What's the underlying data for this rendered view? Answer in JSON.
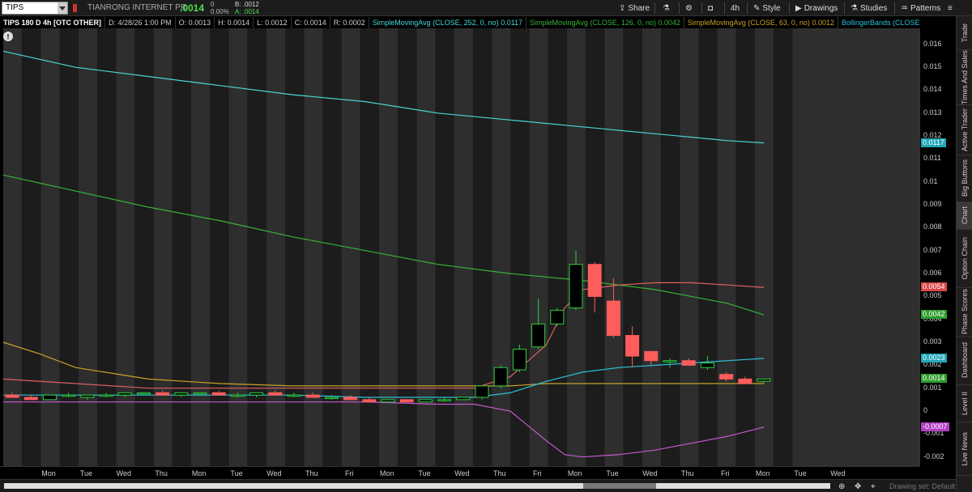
{
  "toolbar": {
    "symbol": "TIPS",
    "company": "TIANRONG INTERNET PR",
    "last": ".0014",
    "change": "0",
    "change_pct": "0.00%",
    "bid": "B: .0012",
    "ask": "A: .0014",
    "buttons": {
      "share": "Share",
      "timeframe": "4h",
      "style": "Style",
      "drawings": "Drawings",
      "studies": "Studies",
      "patterns": "Patterns"
    }
  },
  "infobar": {
    "title": "TIPS 180 D 4h [OTC OTHER]",
    "date": "D: 4/28/26 1:00 PM",
    "open": "O: 0.0013",
    "high": "H: 0.0014",
    "low": "L: 0.0012",
    "close": "C: 0.0014",
    "range": "R: 0.0002",
    "study1": "SimpleMovingAvg (CLOSE, 252, 0, no)",
    "study1_val": "0.0117",
    "study2": "SimpleMovingAvg (CLOSE, 126, 0, no)",
    "study2_val": "0.0042",
    "study3": "SimpleMovingAvg (CLOSE, 63, 0, no)",
    "study3_val": "0.0012",
    "study4": "BollingerBands (CLOSE, 0, 20,..."
  },
  "colors": {
    "sma252": "#4ad6d6",
    "sma126": "#36b336",
    "sma63": "#c9a227",
    "bb_upper": "#e06060",
    "bb_mid": "#2bc0d8",
    "bb_lower": "#c65ad0",
    "up": "#2ecc40",
    "down": "#ff5c5c"
  },
  "yaxis": {
    "ticks": [
      "0.016",
      "0.015",
      "0.014",
      "0.013",
      "0.012",
      "0.011",
      "0.01",
      "0.009",
      "0.008",
      "0.007",
      "0.006",
      "0.005",
      "0.004",
      "0.003",
      "0.002",
      "0.001",
      "0",
      "-0.001",
      "-0.002"
    ],
    "badges": [
      {
        "label": "0.0117",
        "value": 0.0117,
        "color": "#1fa6b8"
      },
      {
        "label": "0.0054",
        "value": 0.0054,
        "color": "#d94848"
      },
      {
        "label": "0.0042",
        "value": 0.0042,
        "color": "#2e9e2e"
      },
      {
        "label": "0.0023",
        "value": 0.0023,
        "color": "#1fa6b8"
      },
      {
        "label": "0.0014",
        "value": 0.0014,
        "color": "#2e9e2e"
      },
      {
        "label": "-0.0007",
        "value": -0.0007,
        "color": "#b33fc4"
      }
    ]
  },
  "xaxis": {
    "labels": [
      "Mon",
      "Tue",
      "Wed",
      "Thu",
      "Mon",
      "Tue",
      "Wed",
      "Thu",
      "Fri",
      "Mon",
      "Tue",
      "Wed",
      "Thu",
      "Fri",
      "Mon",
      "Tue",
      "Wed",
      "Thu",
      "Fri",
      "Mon",
      "Tue",
      "Wed"
    ]
  },
  "chart_data": {
    "type": "candlestick",
    "ylim": [
      -0.0024,
      0.0167
    ],
    "candles": [
      {
        "o": 0.0007,
        "h": 0.0008,
        "l": 0.0006,
        "c": 0.0006
      },
      {
        "o": 0.0006,
        "h": 0.0007,
        "l": 0.0005,
        "c": 0.0005
      },
      {
        "o": 0.0005,
        "h": 0.0007,
        "l": 0.0005,
        "c": 0.0007
      },
      {
        "o": 0.0007,
        "h": 0.0008,
        "l": 0.0006,
        "c": 0.0007
      },
      {
        "o": 0.0006,
        "h": 0.0007,
        "l": 0.0005,
        "c": 0.0007
      },
      {
        "o": 0.0007,
        "h": 0.0008,
        "l": 0.0006,
        "c": 0.0007
      },
      {
        "o": 0.0007,
        "h": 0.0008,
        "l": 0.0006,
        "c": 0.0008
      },
      {
        "o": 0.0008,
        "h": 0.0008,
        "l": 0.0007,
        "c": 0.0008
      },
      {
        "o": 0.0008,
        "h": 0.0009,
        "l": 0.0007,
        "c": 0.0007
      },
      {
        "o": 0.0007,
        "h": 0.0008,
        "l": 0.0006,
        "c": 0.0008
      },
      {
        "o": 0.0008,
        "h": 0.0008,
        "l": 0.0007,
        "c": 0.0008
      },
      {
        "o": 0.0008,
        "h": 0.0009,
        "l": 0.0007,
        "c": 0.0007
      },
      {
        "o": 0.0007,
        "h": 0.0008,
        "l": 0.0006,
        "c": 0.0007
      },
      {
        "o": 0.0007,
        "h": 0.0008,
        "l": 0.0006,
        "c": 0.0008
      },
      {
        "o": 0.0008,
        "h": 0.0009,
        "l": 0.0007,
        "c": 0.0007
      },
      {
        "o": 0.0007,
        "h": 0.0008,
        "l": 0.0006,
        "c": 0.0007
      },
      {
        "o": 0.0007,
        "h": 0.0008,
        "l": 0.0006,
        "c": 0.0006
      },
      {
        "o": 0.0006,
        "h": 0.0007,
        "l": 0.0005,
        "c": 0.0006
      },
      {
        "o": 0.0006,
        "h": 0.0007,
        "l": 0.0005,
        "c": 0.0005
      },
      {
        "o": 0.0005,
        "h": 0.0006,
        "l": 0.0004,
        "c": 0.0004
      },
      {
        "o": 0.0004,
        "h": 0.0005,
        "l": 0.0004,
        "c": 0.0005
      },
      {
        "o": 0.0005,
        "h": 0.0005,
        "l": 0.0004,
        "c": 0.0004
      },
      {
        "o": 0.0004,
        "h": 0.0005,
        "l": 0.0004,
        "c": 0.0005
      },
      {
        "o": 0.0005,
        "h": 0.0006,
        "l": 0.0004,
        "c": 0.0005
      },
      {
        "o": 0.0005,
        "h": 0.0006,
        "l": 0.0005,
        "c": 0.0006
      },
      {
        "o": 0.0006,
        "h": 0.0011,
        "l": 0.0005,
        "c": 0.0011
      },
      {
        "o": 0.0011,
        "h": 0.002,
        "l": 0.001,
        "c": 0.0019
      },
      {
        "o": 0.0018,
        "h": 0.0029,
        "l": 0.0017,
        "c": 0.0027
      },
      {
        "o": 0.0028,
        "h": 0.0049,
        "l": 0.0027,
        "c": 0.0038
      },
      {
        "o": 0.0038,
        "h": 0.0045,
        "l": 0.0037,
        "c": 0.0044
      },
      {
        "o": 0.0045,
        "h": 0.007,
        "l": 0.0044,
        "c": 0.0064
      },
      {
        "o": 0.0064,
        "h": 0.0065,
        "l": 0.0043,
        "c": 0.005
      },
      {
        "o": 0.0048,
        "h": 0.0058,
        "l": 0.0032,
        "c": 0.0033
      },
      {
        "o": 0.0033,
        "h": 0.0037,
        "l": 0.0019,
        "c": 0.0024
      },
      {
        "o": 0.0026,
        "h": 0.0026,
        "l": 0.002,
        "c": 0.0022
      },
      {
        "o": 0.0022,
        "h": 0.0023,
        "l": 0.0019,
        "c": 0.0022
      },
      {
        "o": 0.0022,
        "h": 0.0023,
        "l": 0.002,
        "c": 0.002
      },
      {
        "o": 0.0019,
        "h": 0.0024,
        "l": 0.0018,
        "c": 0.0021
      },
      {
        "o": 0.0016,
        "h": 0.0017,
        "l": 0.0013,
        "c": 0.0014
      },
      {
        "o": 0.0014,
        "h": 0.0015,
        "l": 0.0012,
        "c": 0.0012
      },
      {
        "o": 0.0013,
        "h": 0.0014,
        "l": 0.0012,
        "c": 0.0014
      }
    ],
    "sma252": {
      "x": [
        0,
        20,
        40,
        60,
        80,
        100,
        120,
        140,
        160,
        180,
        200,
        210
      ],
      "y": [
        0.0157,
        0.015,
        0.0146,
        0.0142,
        0.0138,
        0.0135,
        0.013,
        0.0127,
        0.0124,
        0.0121,
        0.0118,
        0.0117
      ]
    },
    "sma126": {
      "x": [
        0,
        20,
        40,
        60,
        80,
        100,
        120,
        140,
        160,
        180,
        200,
        210
      ],
      "y": [
        0.0103,
        0.0096,
        0.0089,
        0.0083,
        0.0076,
        0.007,
        0.0064,
        0.006,
        0.0057,
        0.0053,
        0.0047,
        0.0042
      ]
    },
    "sma63": {
      "x": [
        0,
        10,
        20,
        40,
        60,
        80,
        100,
        120,
        130,
        140,
        150,
        160,
        180,
        210
      ],
      "y": [
        0.003,
        0.0025,
        0.0019,
        0.0014,
        0.0012,
        0.0011,
        0.0011,
        0.0011,
        0.0011,
        0.0011,
        0.0012,
        0.0012,
        0.0012,
        0.0012
      ]
    },
    "bb_upper": {
      "x": [
        0,
        20,
        40,
        60,
        80,
        100,
        120,
        130,
        140,
        150,
        155,
        160,
        170,
        180,
        190,
        200,
        210
      ],
      "y": [
        0.0014,
        0.0012,
        0.001,
        0.001,
        0.001,
        0.001,
        0.001,
        0.001,
        0.0015,
        0.0029,
        0.0045,
        0.0053,
        0.0055,
        0.0056,
        0.0056,
        0.0055,
        0.0054
      ]
    },
    "bb_mid": {
      "x": [
        0,
        20,
        40,
        60,
        80,
        100,
        120,
        130,
        140,
        150,
        160,
        170,
        180,
        190,
        200,
        210
      ],
      "y": [
        0.0007,
        0.0007,
        0.0007,
        0.0007,
        0.0007,
        0.0006,
        0.0006,
        0.0006,
        0.0008,
        0.0013,
        0.0017,
        0.0019,
        0.002,
        0.0021,
        0.0022,
        0.0023
      ],
      "stroke_hint": "cyan"
    },
    "bb_lower": {
      "x": [
        0,
        20,
        40,
        60,
        80,
        100,
        120,
        130,
        140,
        150,
        155,
        160,
        170,
        180,
        190,
        200,
        210
      ],
      "y": [
        0.0004,
        0.0004,
        0.0004,
        0.0004,
        0.0004,
        0.0004,
        0.0003,
        0.0003,
        0.0,
        -0.0013,
        -0.0019,
        -0.002,
        -0.0019,
        -0.0017,
        -0.0014,
        -0.0011,
        -0.0007
      ]
    }
  },
  "sidebar": {
    "tabs": [
      "Trade",
      "Times And Sales",
      "Active Trader",
      "Big Buttons",
      "Chart",
      "Option Chain",
      "Phase Scores",
      "Dashboard",
      "Level II",
      "Live News"
    ]
  },
  "bottombar": {
    "drawing_set": "Drawing set: Default"
  }
}
